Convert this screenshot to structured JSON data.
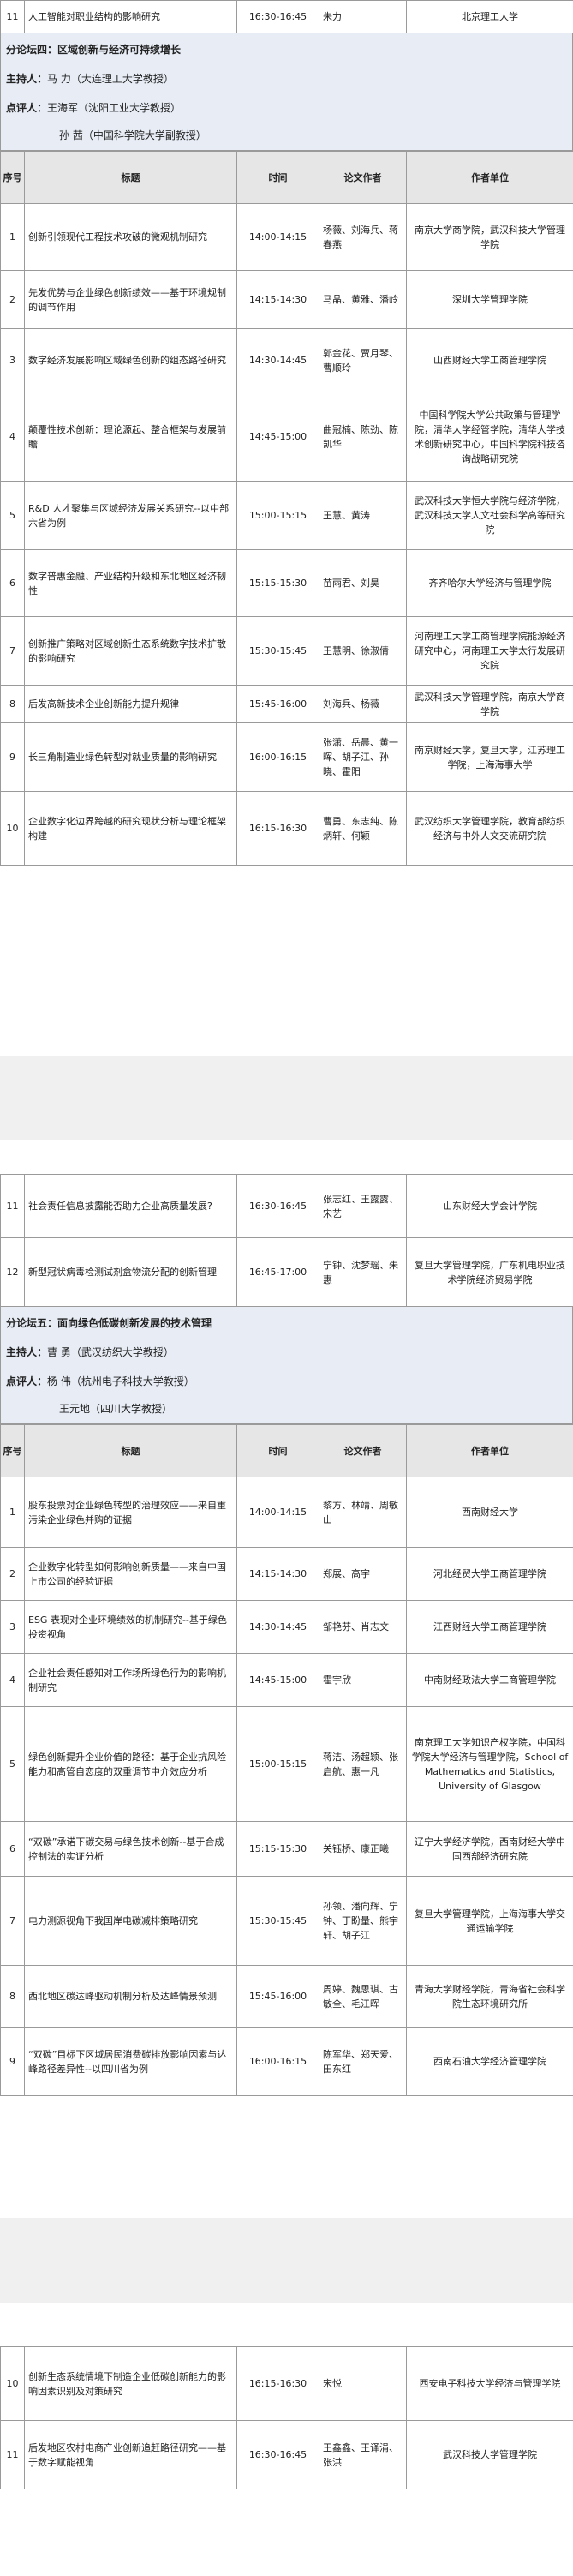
{
  "page1": {
    "top_row": {
      "no": "11",
      "title": "人工智能对职业结构的影响研究",
      "time": "16:30-16:45",
      "authors": "朱力",
      "institution": "北京理工大学"
    },
    "forum": {
      "title": "分论坛四：区域创新与经济可持续增长",
      "host_label": "主持人：",
      "host": "马  力（大连理工大学教授）",
      "reviewer_label": "点评人：",
      "reviewer1": "王海军（沈阳工业大学教授）",
      "reviewer2": "孙  茜（中国科学院大学副教授）"
    },
    "headers": {
      "no": "序号",
      "title": "标题",
      "time": "时间",
      "authors": "论文作者",
      "institution": "作者单位"
    },
    "rows": [
      {
        "no": "1",
        "title": "创新引领现代工程技术攻破的微观机制研究",
        "time": "14:00-14:15",
        "authors": "杨薇、刘海兵、蒋春燕",
        "institution": "南京大学商学院，武汉科技大学管理学院"
      },
      {
        "no": "2",
        "title": "先发优势与企业绿色创新绩效——基于环境规制的调节作用",
        "time": "14:15-14:30",
        "authors": "马晶、黄雅、潘岭",
        "institution": "深圳大学管理学院"
      },
      {
        "no": "3",
        "title": "数字经济发展影响区域绿色创新的组态路径研究",
        "time": "14:30-14:45",
        "authors": "郭金花、贾月琴、曹顺玲",
        "institution": "山西财经大学工商管理学院"
      },
      {
        "no": "4",
        "title": "颠覆性技术创新：理论源起、整合框架与发展前瞻",
        "time": "14:45-15:00",
        "authors": "曲冠楠、陈劲、陈凯华",
        "institution": "中国科学院大学公共政策与管理学院，清华大学经管学院，清华大学技术创新研究中心，中国科学院科技咨询战略研究院"
      },
      {
        "no": "5",
        "title": "R&D 人才聚集与区域经济发展关系研究--以中部六省为例",
        "time": "15:00-15:15",
        "authors": "王慧、黄涛",
        "institution": "武汉科技大学恒大学院与经济学院，武汉科技大学人文社会科学高等研究院"
      },
      {
        "no": "6",
        "title": "数字普惠金融、产业结构升级和东北地区经济韧性",
        "time": "15:15-15:30",
        "authors": "苗雨君、刘昊",
        "institution": "齐齐哈尔大学经济与管理学院"
      },
      {
        "no": "7",
        "title": "创新推广策略对区域创新生态系统数字技术扩散的影响研究",
        "time": "15:30-15:45",
        "authors": "王慧明、徐淑倩",
        "institution": "河南理工大学工商管理学院能源经济研究中心，河南理工大学太行发展研究院"
      },
      {
        "no": "8",
        "title": "后发高新技术企业创新能力提升规律",
        "time": "15:45-16:00",
        "authors": "刘海兵、杨薇",
        "institution": "武汉科技大学管理学院，南京大学商学院"
      },
      {
        "no": "9",
        "title": "长三角制造业绿色转型对就业质量的影响研究",
        "time": "16:00-16:15",
        "authors": "张潇、岳晨、黄一晖、胡子江、孙晓、霍阳",
        "institution": "南京财经大学，复旦大学，江苏理工学院，上海海事大学"
      },
      {
        "no": "10",
        "title": "企业数字化边界跨越的研究现状分析与理论框架构建",
        "time": "16:15-16:30",
        "authors": "曹勇、东志纯、陈炳轩、何颖",
        "institution": "武汉纺织大学管理学院，教育部纺织经济与中外人文交流研究院"
      }
    ]
  },
  "page2": {
    "top_rows": [
      {
        "no": "11",
        "title": "社会责任信息披露能否助力企业高质量发展?",
        "time": "16:30-16:45",
        "authors": "张志红、王露露、宋艺",
        "institution": "山东财经大学会计学院"
      },
      {
        "no": "12",
        "title": "新型冠状病毒检测试剂盒物流分配的创新管理",
        "time": "16:45-17:00",
        "authors": "宁钟、沈梦瑶、朱惠",
        "institution": "复旦大学管理学院，广东机电职业技术学院经济贸易学院"
      }
    ],
    "forum": {
      "title": "分论坛五：面向绿色低碳创新发展的技术管理",
      "host_label": "主持人：",
      "host": "曹  勇（武汉纺织大学教授）",
      "reviewer_label": "点评人：",
      "reviewer1": "杨  伟（杭州电子科技大学教授）",
      "reviewer2": "王元地（四川大学教授）"
    },
    "headers": {
      "no": "序号",
      "title": "标题",
      "time": "时间",
      "authors": "论文作者",
      "institution": "作者单位"
    },
    "rows": [
      {
        "no": "1",
        "title": "股东投票对企业绿色转型的治理效应——来自重污染企业绿色并购的证据",
        "time": "14:00-14:15",
        "authors": "黎方、林靖、周敏山",
        "institution": "西南财经大学"
      },
      {
        "no": "2",
        "title": "企业数字化转型如何影响创新质量——来自中国上市公司的经验证据",
        "time": "14:15-14:30",
        "authors": "郑展、高宇",
        "institution": "河北经贸大学工商管理学院"
      },
      {
        "no": "3",
        "title": "ESG 表现对企业环境绩效的机制研究--基于绿色投资视角",
        "time": "14:30-14:45",
        "authors": "邹艳芬、肖志文",
        "institution": "江西财经大学工商管理学院"
      },
      {
        "no": "4",
        "title": "企业社会责任感知对工作场所绿色行为的影响机制研究",
        "time": "14:45-15:00",
        "authors": "霍宇欣",
        "institution": "中南财经政法大学工商管理学院"
      },
      {
        "no": "5",
        "title": "绿色创新提升企业价值的路径：基于企业抗风险能力和高管自恋度的双重调节中介效应分析",
        "time": "15:00-15:15",
        "authors": "蒋洁、汤超颖、张启航、惠一凡",
        "institution": "南京理工大学知识产权学院，中国科学院大学经济与管理学院，School of Mathematics and Statistics, University of Glasgow"
      },
      {
        "no": "6",
        "title": "“双碳”承诺下碳交易与绿色技术创新--基于合成控制法的实证分析",
        "time": "15:15-15:30",
        "authors": "关钰桥、康正曦",
        "institution": "辽宁大学经济学院，西南财经大学中国西部经济研究院"
      },
      {
        "no": "7",
        "title": "电力测源视角下我国岸电碳减排策略研究",
        "time": "15:30-15:45",
        "authors": "孙领、潘向辉、宁钟、丁盼量、熊宇轩、胡子江",
        "institution": "复旦大学管理学院，上海海事大学交通运输学院"
      },
      {
        "no": "8",
        "title": "西北地区碳达峰驱动机制分析及达峰情景预测",
        "time": "15:45-16:00",
        "authors": "周婷、魏思琪、古敏全、毛江晖",
        "institution": "青海大学财经学院，青海省社会科学院生态环境研究所"
      },
      {
        "no": "9",
        "title": "“双碳”目标下区域居民消费碳排放影响因素与达峰路径差异性--以四川省为例",
        "time": "16:00-16:15",
        "authors": "陈军华、郑天爱、田东红",
        "institution": "西南石油大学经济管理学院"
      }
    ]
  },
  "page3": {
    "rows": [
      {
        "no": "10",
        "title": "创新生态系统情境下制造企业低碳创新能力的影响因素识别及对策研究",
        "time": "16:15-16:30",
        "authors": "宋悦",
        "institution": "西安电子科技大学经济与管理学院"
      },
      {
        "no": "11",
        "title": "后发地区农村电商产业创新追赶路径研究——基于数字赋能视角",
        "time": "16:30-16:45",
        "authors": "王鑫鑫、王译涓、张洪",
        "institution": "武汉科技大学管理学院"
      }
    ]
  }
}
